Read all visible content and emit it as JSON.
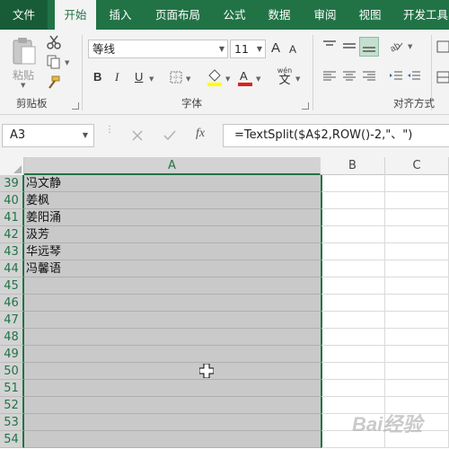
{
  "tabs": [
    "文件",
    "开始",
    "插入",
    "页面布局",
    "公式",
    "数据",
    "审阅",
    "视图",
    "开发工具"
  ],
  "ribbon": {
    "clipboard": {
      "paste_label": "粘贴",
      "group_label": "剪贴板"
    },
    "font": {
      "font_name": "等线",
      "font_size": "11",
      "bold": "B",
      "italic": "I",
      "underline": "U",
      "group_label": "字体",
      "grow": "A",
      "shrink": "A",
      "phonetic": "wén",
      "phonetic_char": "文"
    },
    "alignment": {
      "group_label": "对齐方式"
    }
  },
  "formula_bar": {
    "name_box": "A3",
    "fx": "fx",
    "formula": "=TextSplit($A$2,ROW()-2,\"、\")"
  },
  "grid": {
    "columns": [
      "A",
      "B",
      "C"
    ],
    "rows": [
      {
        "num": "39",
        "a": "冯文静"
      },
      {
        "num": "40",
        "a": "姜枫"
      },
      {
        "num": "41",
        "a": "姜阳涌"
      },
      {
        "num": "42",
        "a": "汲芳"
      },
      {
        "num": "43",
        "a": "华远琴"
      },
      {
        "num": "44",
        "a": "冯馨语"
      },
      {
        "num": "45",
        "a": ""
      },
      {
        "num": "46",
        "a": ""
      },
      {
        "num": "47",
        "a": ""
      },
      {
        "num": "48",
        "a": ""
      },
      {
        "num": "49",
        "a": ""
      },
      {
        "num": "50",
        "a": ""
      },
      {
        "num": "51",
        "a": ""
      },
      {
        "num": "52",
        "a": ""
      },
      {
        "num": "53",
        "a": ""
      },
      {
        "num": "54",
        "a": ""
      }
    ]
  },
  "colors": {
    "accent": "#217346",
    "selection": "#c9c9c9"
  },
  "watermark": "Bai经验"
}
